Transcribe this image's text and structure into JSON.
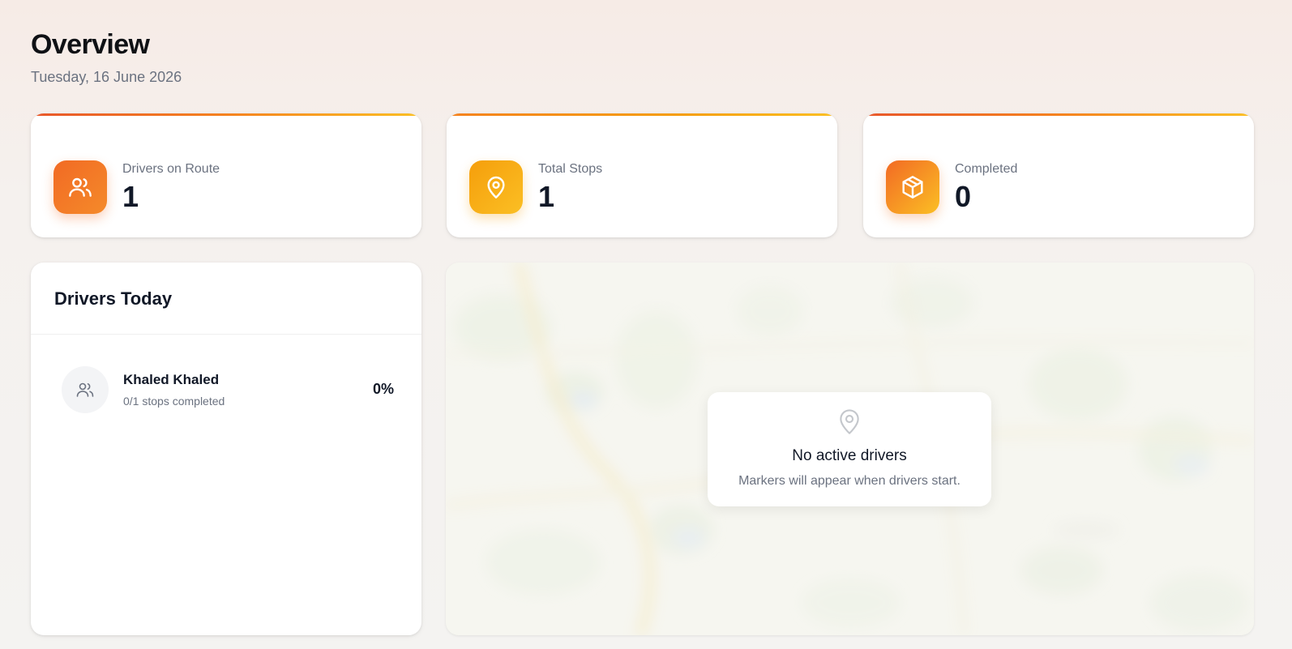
{
  "header": {
    "title": "Overview",
    "date": "Tuesday, 16 June 2026"
  },
  "stats": [
    {
      "label": "Drivers on Route",
      "value": "1",
      "icon": "users-icon"
    },
    {
      "label": "Total Stops",
      "value": "1",
      "icon": "map-pin-icon"
    },
    {
      "label": "Completed",
      "value": "0",
      "icon": "package-icon"
    }
  ],
  "drivers_panel": {
    "title": "Drivers Today",
    "drivers": [
      {
        "name": "Khaled Khaled",
        "progress_text": "0/1 stops completed",
        "percent": "0%"
      }
    ]
  },
  "map": {
    "empty_title": "No active drivers",
    "empty_subtitle": "Markers will appear when drivers start."
  },
  "colors": {
    "accent": "#f26a24",
    "accent_amber": "#fbbf24"
  }
}
